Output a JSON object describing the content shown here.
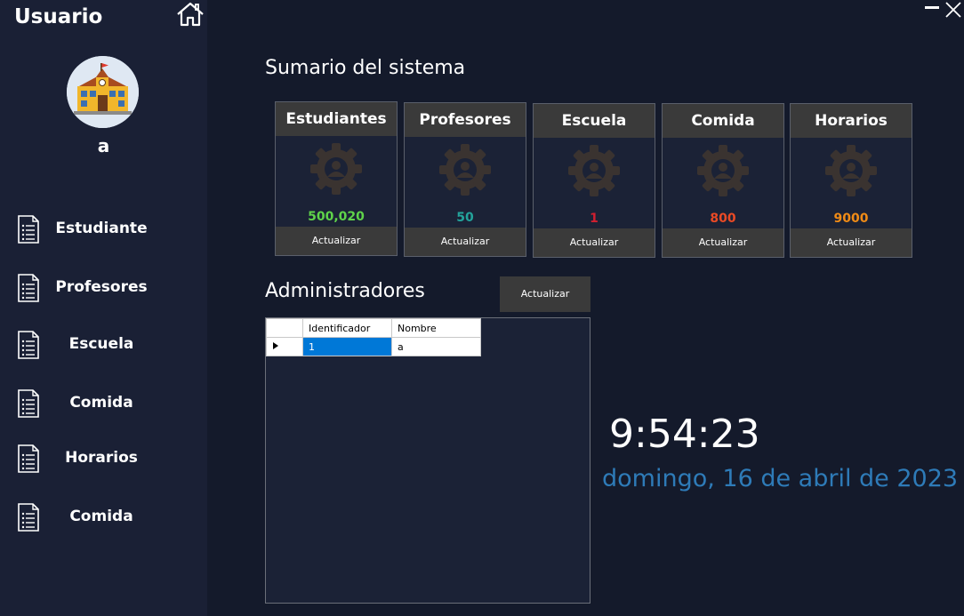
{
  "sidebar": {
    "title": "Usuario",
    "user_name": "a",
    "items": [
      {
        "label": "Estudiante"
      },
      {
        "label": "Profesores"
      },
      {
        "label": "Escuela"
      },
      {
        "label": "Comida"
      },
      {
        "label": "Horarios"
      },
      {
        "label": "Comida"
      }
    ]
  },
  "icons": {
    "home": "home-icon",
    "avatar": "school-building-icon",
    "nav": "document-list-icon",
    "card": "user-gear-icon",
    "minimize": "minimize-icon",
    "close": "close-icon"
  },
  "summary": {
    "title": "Sumario del sistema",
    "cards": [
      {
        "title": "Estudiantes",
        "value": "500,020",
        "value_color": "#5fd34a",
        "button": "Actualizar"
      },
      {
        "title": "Profesores",
        "value": "50",
        "value_color": "#23a39b",
        "button": "Actualizar"
      },
      {
        "title": "Escuela",
        "value": "1",
        "value_color": "#d01f2f",
        "button": "Actualizar"
      },
      {
        "title": "Comida",
        "value": "800",
        "value_color": "#ea4a25",
        "button": "Actualizar"
      },
      {
        "title": "Horarios",
        "value": "9000",
        "value_color": "#f08b16",
        "button": "Actualizar"
      }
    ]
  },
  "admins": {
    "title": "Administradores",
    "refresh_button": "Actualizar",
    "columns": [
      "Identificador",
      "Nombre"
    ],
    "rows": [
      {
        "id": "1",
        "name": "a"
      }
    ]
  },
  "clock": {
    "time": "9:54:23",
    "date": "domingo, 16 de abril de 2023"
  },
  "colors": {
    "background": "#141a2b",
    "sidebar": "#1a2035",
    "card_header": "#3a3a3a",
    "date_text": "#2e7bb8",
    "selection": "#0078d7"
  }
}
